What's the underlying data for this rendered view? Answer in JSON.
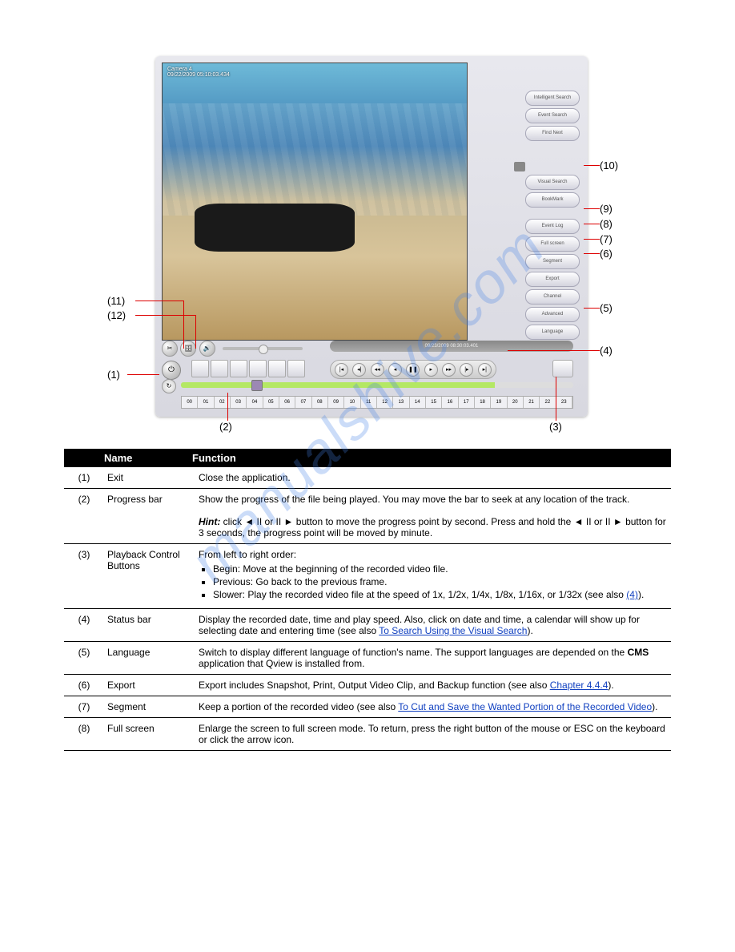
{
  "watermark": "manualshive.com",
  "video": {
    "camera_label": "Camera 4",
    "datestamp": "09/22/2009 05:10:03.434",
    "timebar_text": "09/23/2009 08:30:03.401"
  },
  "side_buttons": {
    "intelligent_search": "Intelligent Search",
    "event_search": "Event Search",
    "find_next": "Find Next",
    "visual_search": "Visual Search",
    "bookmark": "BookMark",
    "event_log": "Event Log",
    "full_screen": "Full screen",
    "segment": "Segment",
    "export": "Export",
    "channel": "Channel",
    "advanced": "Advanced",
    "language": "Language"
  },
  "hour_ruler": [
    "00",
    "01",
    "02",
    "03",
    "04",
    "05",
    "06",
    "07",
    "08",
    "09",
    "10",
    "11",
    "12",
    "13",
    "14",
    "15",
    "16",
    "17",
    "18",
    "19",
    "20",
    "21",
    "22",
    "23"
  ],
  "callouts": {
    "c1": "(1)",
    "c2": "(2)",
    "c3": "(3)",
    "c4": "(4)",
    "c5": "(5)",
    "c6": "(6)",
    "c7": "(7)",
    "c8": "(8)",
    "c9": "(9)",
    "c10": "(10)",
    "c11": "(11)",
    "c12": "(12)"
  },
  "table_header": {
    "name": "Name",
    "function": "Function"
  },
  "rows": [
    {
      "num": "(1)",
      "name": "Exit",
      "desc_plain": "Close the application."
    },
    {
      "num": "(2)",
      "name": "Progress bar",
      "desc_lead": "Show the progress of the file being played. You may move the bar to seek at any location of the track.",
      "hint_label": "Hint:",
      "hint_text": "click ◄ II or II ► button to move the progress point by second. Press and hold the ◄ II or II ► button for 3 seconds, the progress point will be moved by minute."
    },
    {
      "num": "(3)",
      "name": "Playback Control Buttons",
      "desc_lead": "From left to right order:",
      "b1": "Begin: Move at the beginning of the recorded video file.",
      "b2": "Previous: Go back to the previous frame.",
      "b3_lead": "Slower: Play the recorded video file at the speed of 1x, 1/2x, 1/4x, 1/8x, 1/16x, or 1/32x (see also ",
      "b3_link": "(4)",
      "b3_tail": ")."
    },
    {
      "num": "(4)",
      "name": "Status bar",
      "desc_lead": "Display the recorded date, time and play speed. Also, click on date and time, a calendar will show up for selecting date and entering time (see also ",
      "link": "To Search Using the Visual Search",
      "tail": ")."
    },
    {
      "num": "(5)",
      "name": "Language",
      "desc_lead": "Switch to display different language of function's name. The support languages are depended on the ",
      "link_bold_pre": "",
      "link": "CMS",
      "link_post": " application that Qview is installed from."
    },
    {
      "num": "(6)",
      "name": "Export",
      "desc_lead": "Export includes Snapshot, Print, Output Video Clip, and Backup function (see also ",
      "link": "Chapter 4.4.4",
      "tail": ")."
    },
    {
      "num": "(7)",
      "name": "Segment",
      "desc_lead": "Keep a portion of the recorded video (see also ",
      "link": "To Cut and Save the Wanted Portion of the Recorded Video",
      "tail": ")."
    },
    {
      "num": "(8)",
      "name": "Full screen",
      "desc_plain": "Enlarge the screen to full screen mode. To return, press the right button of the mouse or ESC on the keyboard or click the arrow icon."
    }
  ]
}
